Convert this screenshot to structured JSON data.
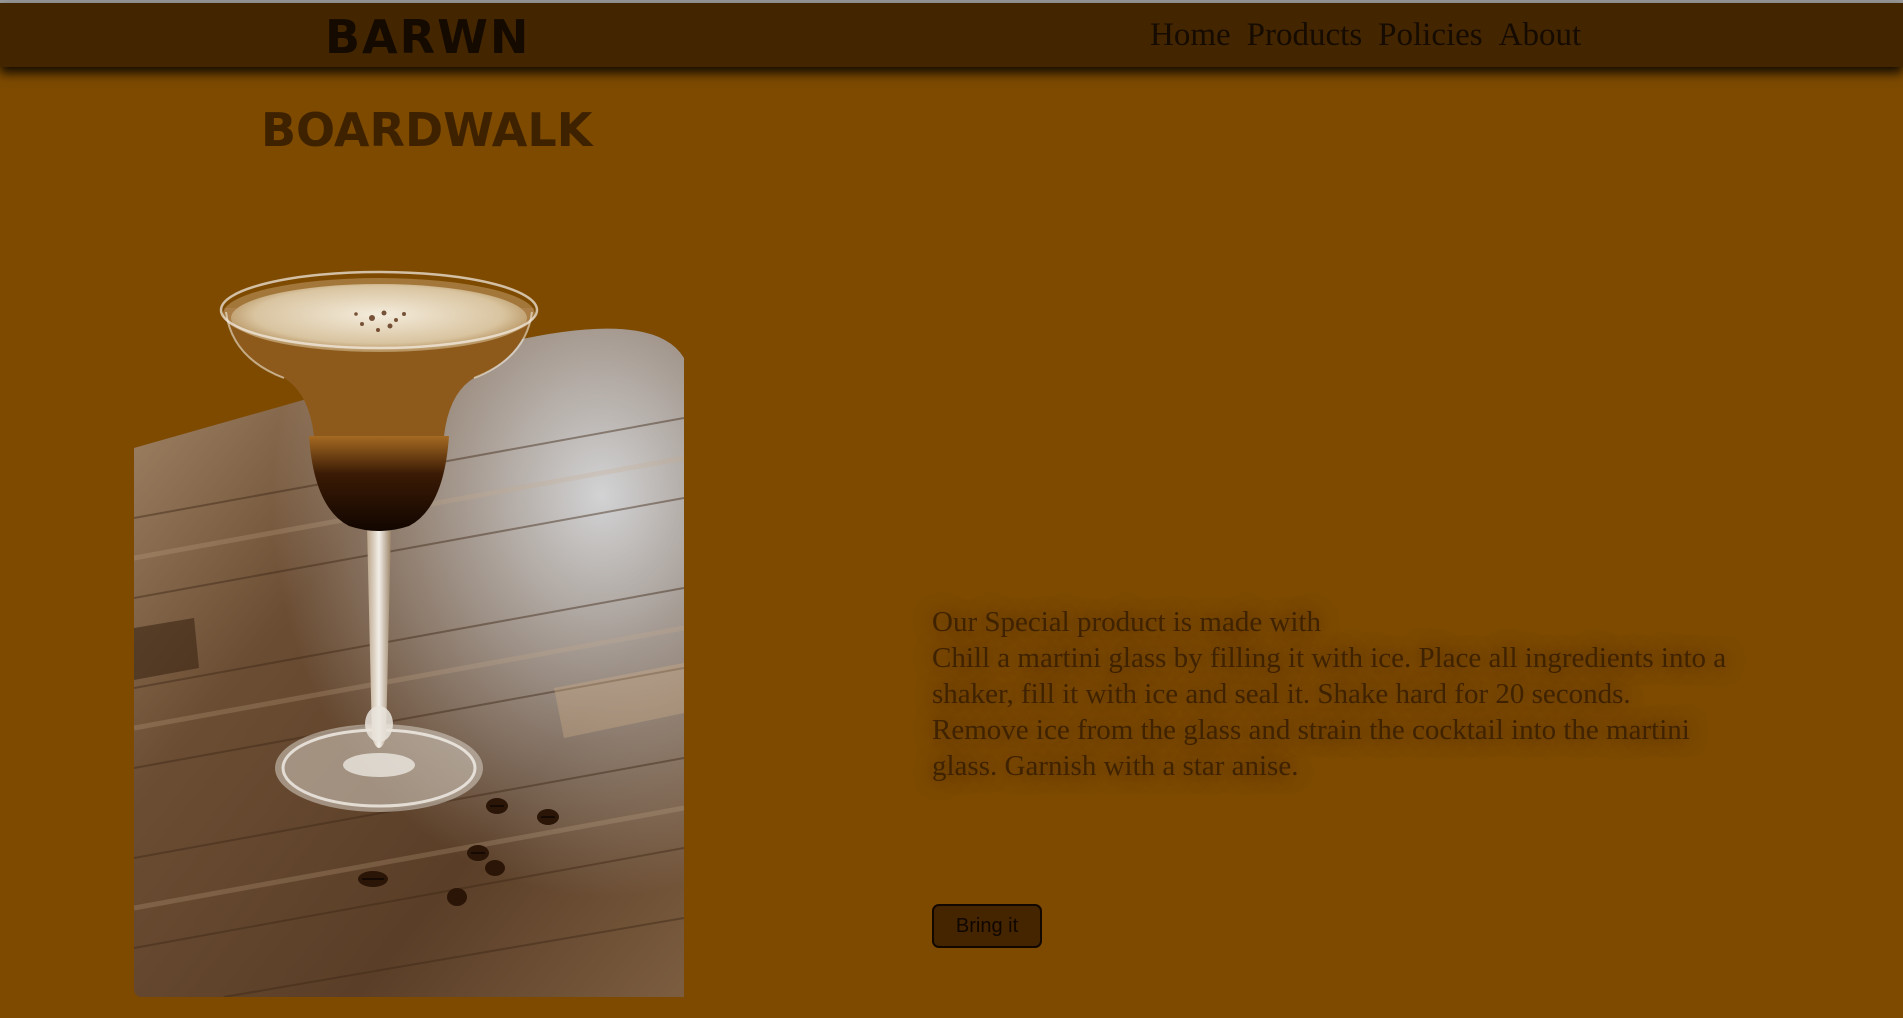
{
  "header": {
    "brand": "BARWN",
    "nav": [
      "Home",
      "Products",
      "Policies",
      "About"
    ]
  },
  "main": {
    "title": "BOARDWALK",
    "description": [
      "Our Special product is made with",
      "Chill a martini glass by filling it with ice. Place all ingredients into a shaker, fill it with ice and seal it. Shake hard for 20 seconds.",
      "Remove ice from the glass and strain the cocktail into the martini glass. Garnish with a star anise."
    ],
    "cta_label": "Bring it"
  },
  "colors": {
    "page_background": "#7d4a00",
    "navbar_background": "#432500",
    "title_color": "#3e2200",
    "text_color": "#3f2200",
    "button_background": "#452400"
  }
}
